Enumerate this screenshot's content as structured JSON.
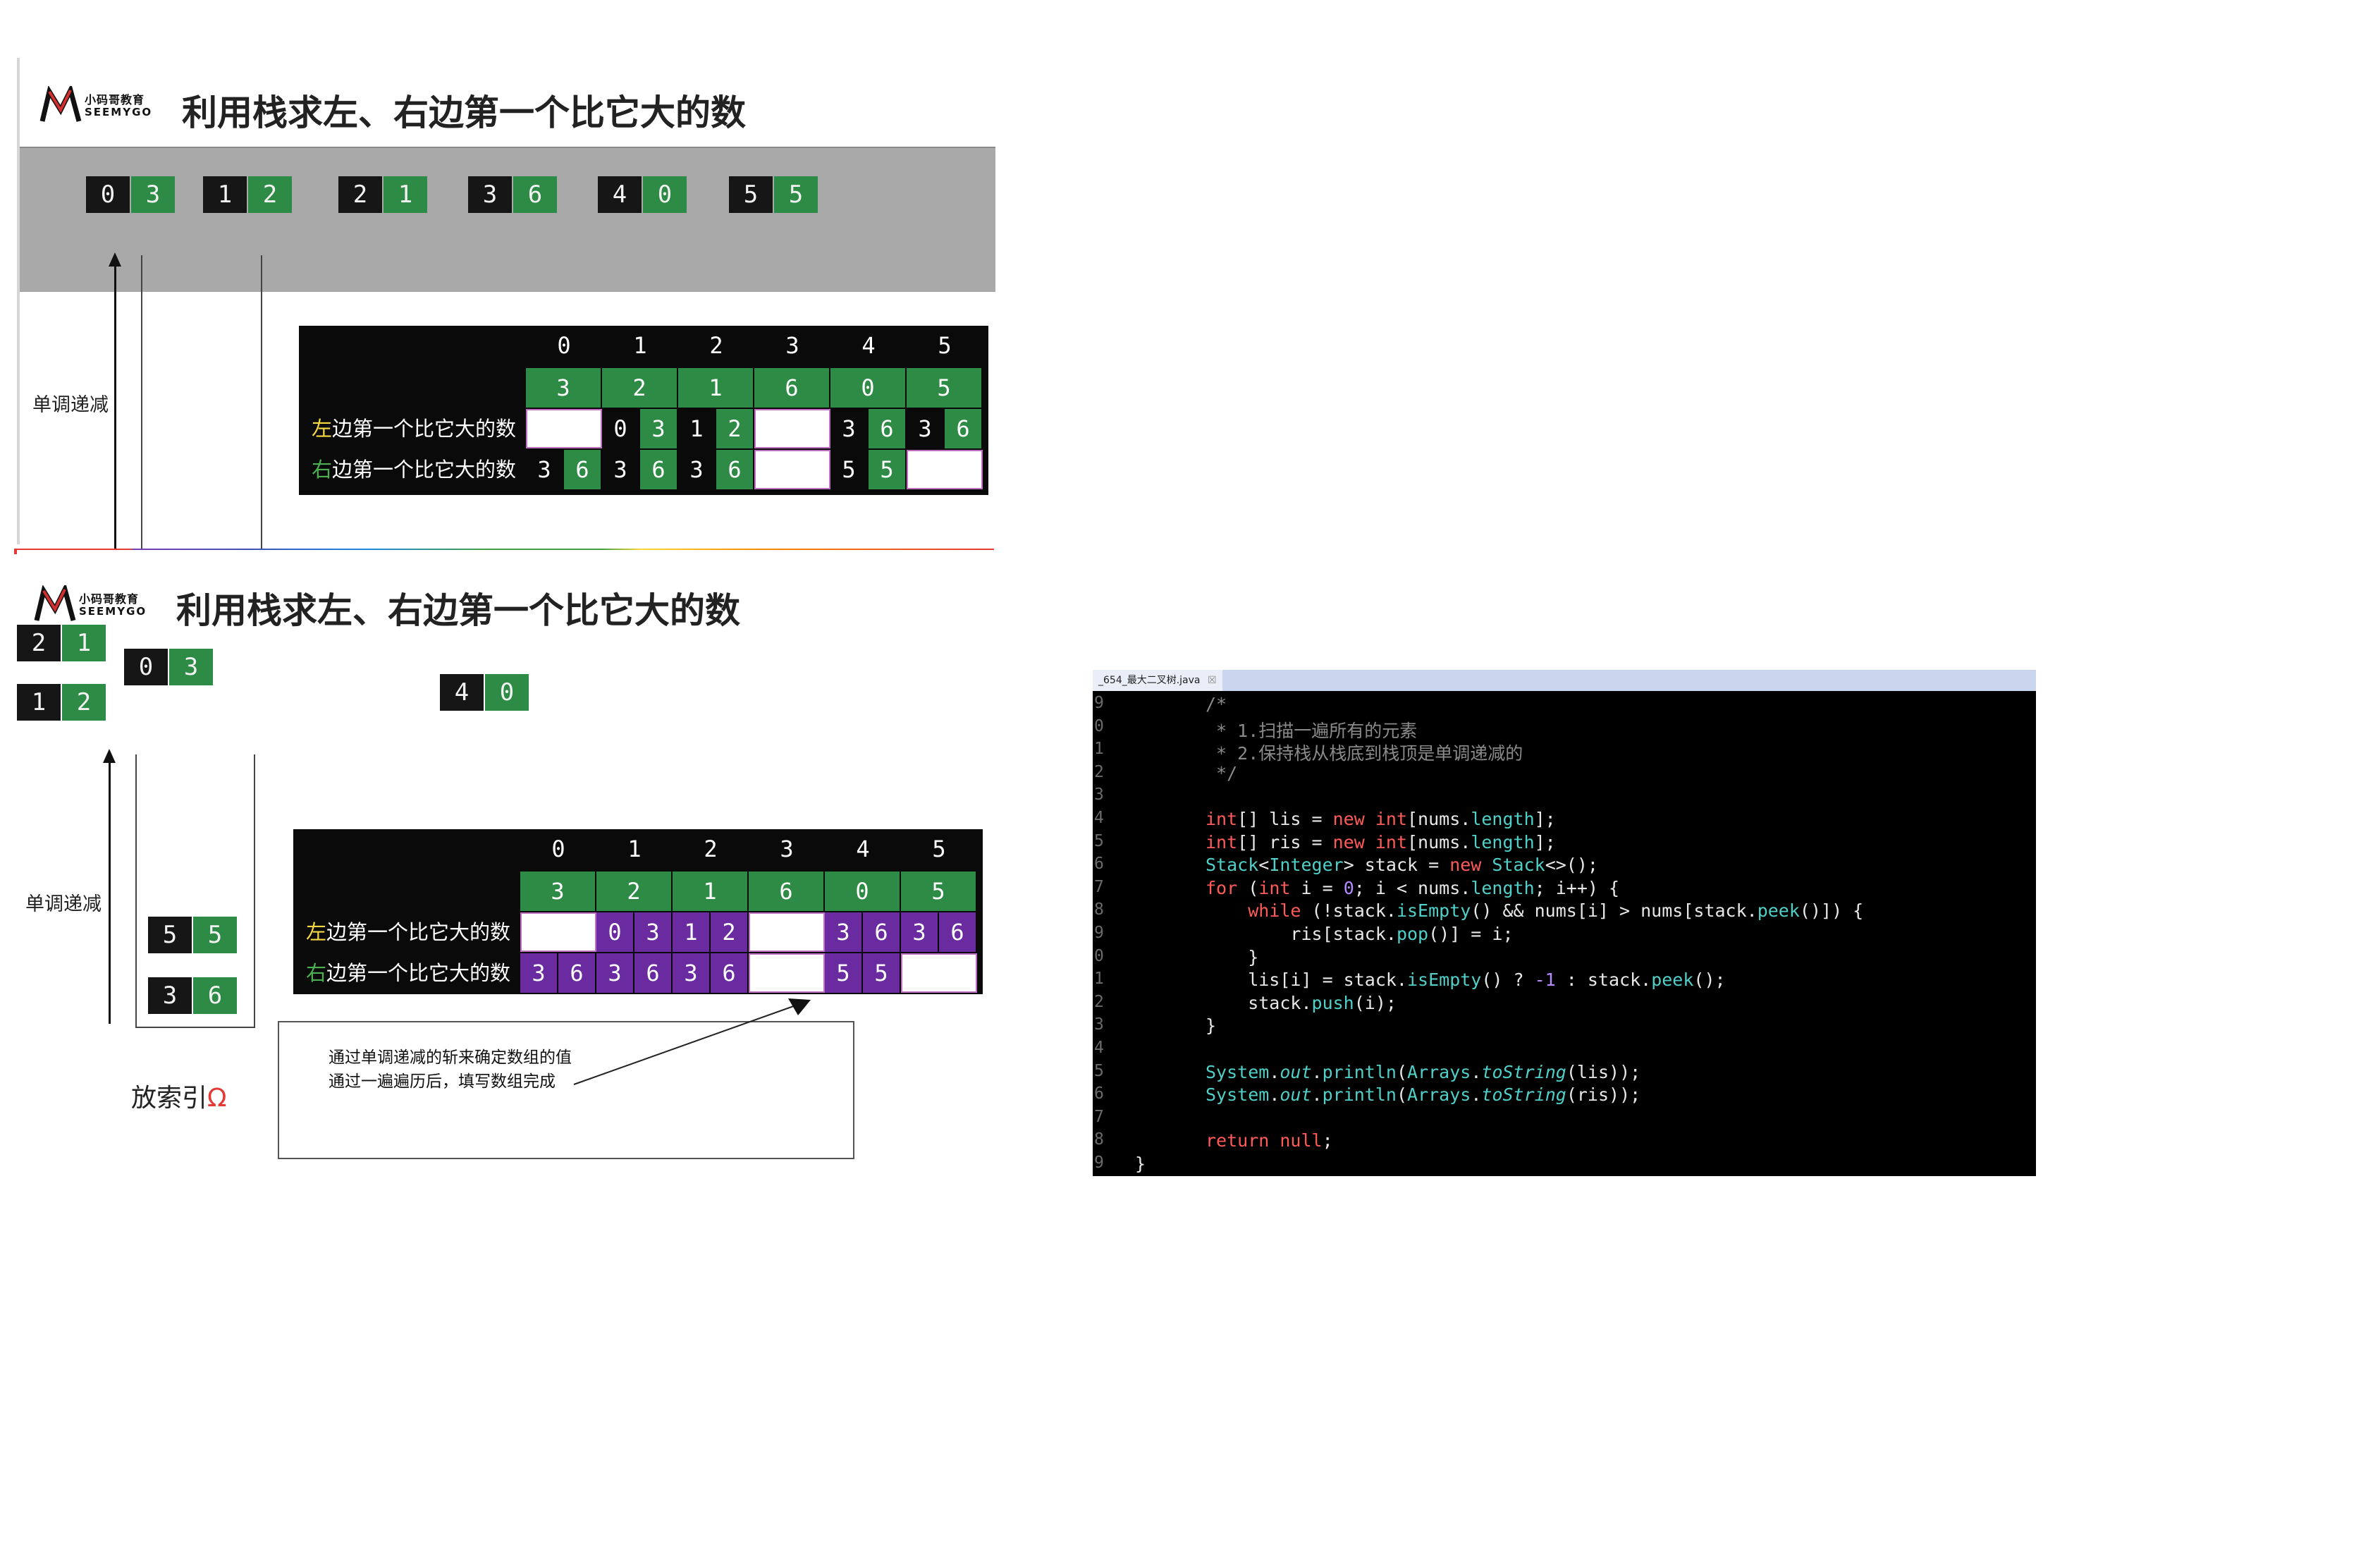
{
  "slide1": {
    "logo": {
      "cn": "小码哥教育",
      "en": "SEEMYGO"
    },
    "title": "利用栈求左、右边第一个比它大的数",
    "pairs": [
      {
        "k": "0",
        "v": "3"
      },
      {
        "k": "1",
        "v": "2"
      },
      {
        "k": "2",
        "v": "1"
      },
      {
        "k": "3",
        "v": "6"
      },
      {
        "k": "4",
        "v": "0"
      },
      {
        "k": "5",
        "v": "5"
      }
    ],
    "stack_label": "单调递减",
    "table": {
      "indices": [
        "0",
        "1",
        "2",
        "3",
        "4",
        "5"
      ],
      "values": [
        "3",
        "2",
        "1",
        "6",
        "0",
        "5"
      ],
      "left_label_prefix": "左",
      "left_label_rest": "边第一个比它大的数",
      "right_label_prefix": "右",
      "right_label_rest": "边第一个比它大的数",
      "left_row": [
        [
          "",
          ""
        ],
        [
          "0",
          "3"
        ],
        [
          "1",
          "2"
        ],
        [
          "",
          ""
        ],
        [
          "3",
          "6"
        ],
        [
          "3",
          "6"
        ]
      ],
      "right_row": [
        [
          "3",
          "6"
        ],
        [
          "3",
          "6"
        ],
        [
          "3",
          "6"
        ],
        [
          "",
          ""
        ],
        [
          "5",
          "5"
        ],
        [
          "",
          ""
        ]
      ]
    }
  },
  "slide2": {
    "logo": {
      "cn": "小码哥教育",
      "en": "SEEMYGO"
    },
    "title": "利用栈求左、右边第一个比它大的数",
    "floating_pairs": [
      {
        "k": "2",
        "v": "1"
      },
      {
        "k": "0",
        "v": "3"
      },
      {
        "k": "1",
        "v": "2"
      },
      {
        "k": "4",
        "v": "0"
      }
    ],
    "stack_label": "单调递减",
    "stack_items": [
      {
        "k": "5",
        "v": "5"
      },
      {
        "k": "3",
        "v": "6"
      }
    ],
    "index_label": "放索引",
    "index_symbol": "Ω",
    "table": {
      "indices": [
        "0",
        "1",
        "2",
        "3",
        "4",
        "5"
      ],
      "values": [
        "3",
        "2",
        "1",
        "6",
        "0",
        "5"
      ],
      "left_label_prefix": "左",
      "left_label_rest": "边第一个比它大的数",
      "right_label_prefix": "右",
      "right_label_rest": "边第一个比它大的数",
      "left_row": [
        [
          "",
          ""
        ],
        [
          "0",
          "3"
        ],
        [
          "1",
          "2"
        ],
        [
          "",
          ""
        ],
        [
          "3",
          "6"
        ],
        [
          "3",
          "6"
        ]
      ],
      "right_row": [
        [
          "3",
          "6"
        ],
        [
          "3",
          "6"
        ],
        [
          "3",
          "6"
        ],
        [
          "",
          ""
        ],
        [
          "5",
          "5"
        ],
        [
          "",
          ""
        ]
      ]
    },
    "note": {
      "line1": "通过单调递减的斩来确定数组的值",
      "line2": "通过一遍遍历后，填写数组完成"
    }
  },
  "editor": {
    "tab_label": "_654_最大二叉树.java",
    "tab_close": "☒",
    "gutter": [
      "9",
      "0",
      "1",
      "2",
      "3",
      "4",
      "5",
      "6",
      "7",
      "8",
      "9",
      "0",
      "1",
      "2",
      "3",
      "4",
      "5",
      "6",
      "7",
      "8",
      "9"
    ],
    "lines": [
      "/*",
      " * 1.扫描一遍所有的元素",
      " * 2.保持栈从栈底到栈顶是单调递减的",
      " */",
      "",
      "int[] lis = new int[nums.length];",
      "int[] ris = new int[nums.length];",
      "Stack<Integer> stack = new Stack<>();",
      "for (int i = 0; i < nums.length; i++) {",
      "    while (!stack.isEmpty() && nums[i] > nums[stack.peek()]) {",
      "        ris[stack.pop()] = i;",
      "    }",
      "    lis[i] = stack.isEmpty() ? -1 : stack.peek();",
      "    stack.push(i);",
      "}",
      "",
      "System.out.println(Arrays.toString(lis));",
      "System.out.println(Arrays.toString(ris));",
      "",
      "return null;",
      "}"
    ]
  },
  "colors": {
    "green": "#2e8b45",
    "purple": "#6a2aa0",
    "black": "#0a0a0a",
    "gray_band": "#a9a9a9"
  }
}
